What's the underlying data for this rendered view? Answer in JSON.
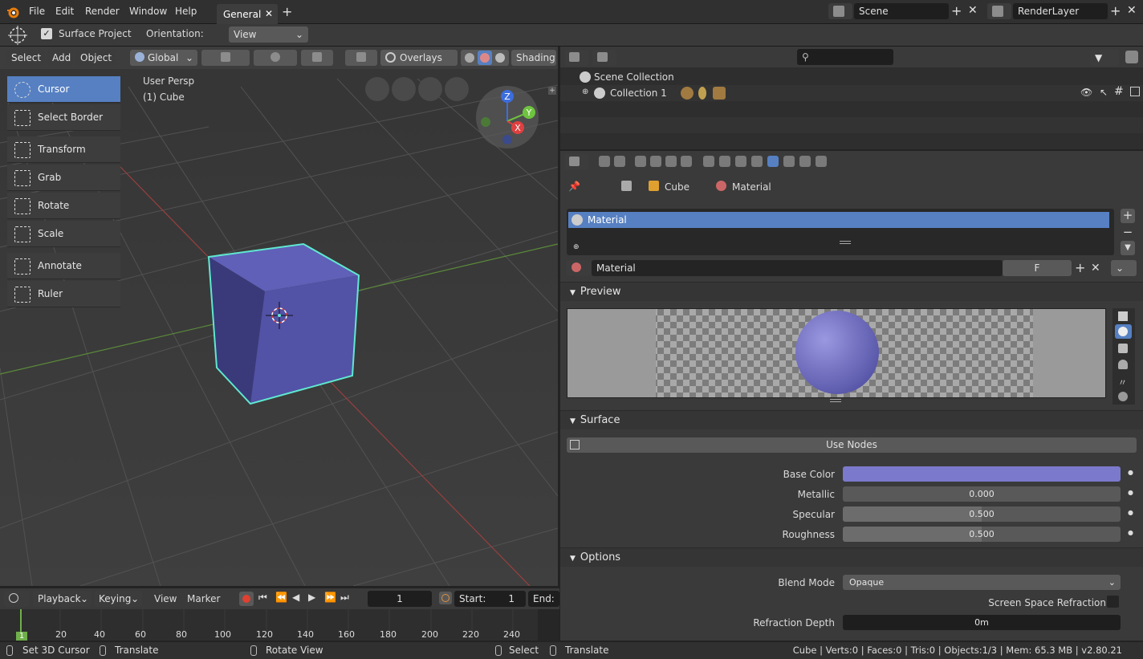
{
  "menubar": {
    "items": [
      "File",
      "Edit",
      "Render",
      "Window",
      "Help"
    ],
    "workspace_tab": "General",
    "scene_label": "Scene",
    "renderlayer_label": "RenderLayer"
  },
  "tool_header": {
    "surface_project_label": "Surface Project",
    "orientation_label": "Orientation:",
    "orientation_value": "View"
  },
  "viewport": {
    "menu": [
      "Select",
      "Add",
      "Object"
    ],
    "transform_space": "Global",
    "overlays_label": "Overlays",
    "shading_label": "Shading",
    "view_name": "User Persp",
    "object_name": "(1) Cube",
    "gizmo_axes": [
      "Z",
      "Y",
      "X"
    ],
    "tools": [
      {
        "label": "Cursor",
        "icon": "cursor-icon",
        "active": true
      },
      {
        "label": "Select Border",
        "icon": "select-border-icon",
        "active": false
      },
      {
        "label": "Transform",
        "icon": "transform-icon",
        "active": false
      },
      {
        "label": "Grab",
        "icon": "grab-icon",
        "active": false
      },
      {
        "label": "Rotate",
        "icon": "rotate-icon",
        "active": false
      },
      {
        "label": "Scale",
        "icon": "scale-icon",
        "active": false
      },
      {
        "label": "Annotate",
        "icon": "annotate-icon",
        "active": false
      },
      {
        "label": "Ruler",
        "icon": "ruler-icon",
        "active": false
      }
    ],
    "cube_color": "#5555a8",
    "selection_color": "#5fe8d0"
  },
  "outliner": {
    "scene_collection": "Scene Collection",
    "collection": "Collection 1"
  },
  "properties": {
    "breadcrumb": [
      "Cube",
      "Material"
    ],
    "material_slot": "Material",
    "material_name": "Material",
    "fake_user": "F",
    "sections": {
      "preview": "Preview",
      "surface": "Surface",
      "options": "Options"
    },
    "use_nodes": "Use Nodes",
    "fields": {
      "base_color_label": "Base Color",
      "base_color": "#7b79cc",
      "metallic_label": "Metallic",
      "metallic": "0.000",
      "specular_label": "Specular",
      "specular": "0.500",
      "roughness_label": "Roughness",
      "roughness": "0.500",
      "blend_mode_label": "Blend Mode",
      "blend_mode": "Opaque",
      "ssr_label": "Screen Space Refraction",
      "refraction_depth_label": "Refraction Depth",
      "refraction_depth": "0m"
    }
  },
  "timeline": {
    "playback": "Playback",
    "keying": "Keying",
    "view": "View",
    "marker": "Marker",
    "current_frame": "1",
    "start_label": "Start:",
    "start_value": "1",
    "end_label": "End:",
    "frame_indicator": "1",
    "ticks": [
      "20",
      "40",
      "60",
      "80",
      "100",
      "120",
      "140",
      "160",
      "180",
      "200",
      "220",
      "240"
    ]
  },
  "statusbar": {
    "set_cursor": "Set 3D Cursor",
    "translate1": "Translate",
    "rotate_view": "Rotate View",
    "select": "Select",
    "translate2": "Translate",
    "stats": "Cube | Verts:0 | Faces:0 | Tris:0 | Objects:1/3 | Mem: 65.3 MB | v2.80.21"
  }
}
